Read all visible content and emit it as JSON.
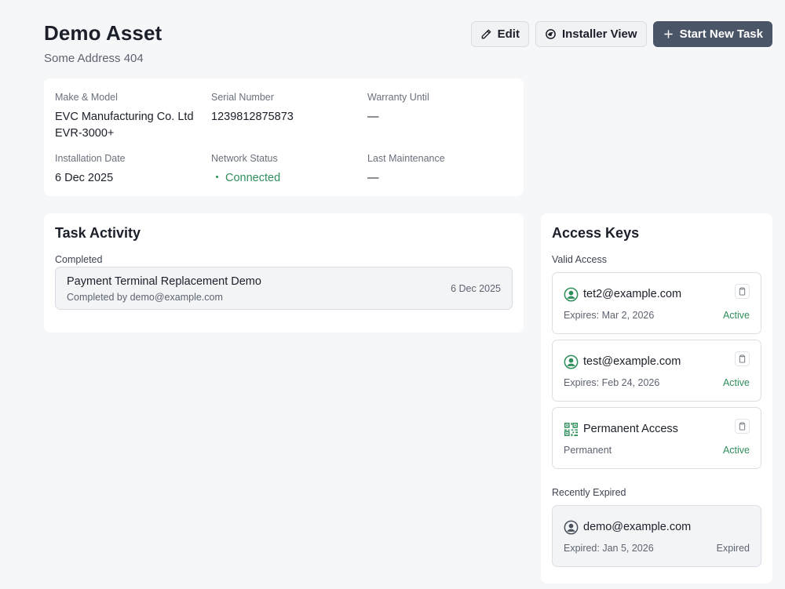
{
  "asset": {
    "title": "Demo Asset",
    "address": "Some Address 404"
  },
  "actions": {
    "edit_label": "Edit",
    "installer_view_label": "Installer View",
    "start_task_label": "Start New Task"
  },
  "details": {
    "make_model": {
      "label": "Make & Model",
      "value_line1": "EVC Manufacturing Co. Ltd",
      "value_line2": "EVR-3000+"
    },
    "serial_number": {
      "label": "Serial Number",
      "value": "1239812875873"
    },
    "warranty_until": {
      "label": "Warranty Until",
      "value": "—"
    },
    "installation_date": {
      "label": "Installation Date",
      "value": "6 Dec 2025"
    },
    "network_status": {
      "label": "Network Status",
      "value": "Connected"
    },
    "last_maintenance": {
      "label": "Last Maintenance",
      "value": "—"
    }
  },
  "task_activity": {
    "title": "Task Activity",
    "completed_label": "Completed",
    "tasks": [
      {
        "name": "Payment Terminal Replacement Demo",
        "completed_by": "Completed by demo@example.com",
        "date": "6 Dec 2025"
      }
    ]
  },
  "access_keys": {
    "title": "Access Keys",
    "valid_label": "Valid Access",
    "valid": [
      {
        "name": "tet2@example.com",
        "icon": "user-circle-icon",
        "meta": "Expires: Mar 2, 2026",
        "status": "Active"
      },
      {
        "name": "test@example.com",
        "icon": "user-circle-icon",
        "meta": "Expires: Feb 24, 2026",
        "status": "Active"
      },
      {
        "name": "Permanent Access",
        "icon": "qr-code-icon",
        "meta": "Permanent",
        "status": "Active"
      }
    ],
    "expired_label": "Recently Expired",
    "expired": [
      {
        "name": "demo@example.com",
        "icon": "user-circle-icon",
        "meta": "Expired: Jan 5, 2026",
        "status": "Expired"
      }
    ]
  },
  "colors": {
    "background": "#f6f7f9",
    "primary_button": "#4a5568",
    "success": "#2f8f5b",
    "muted_text": "#5d6370"
  }
}
